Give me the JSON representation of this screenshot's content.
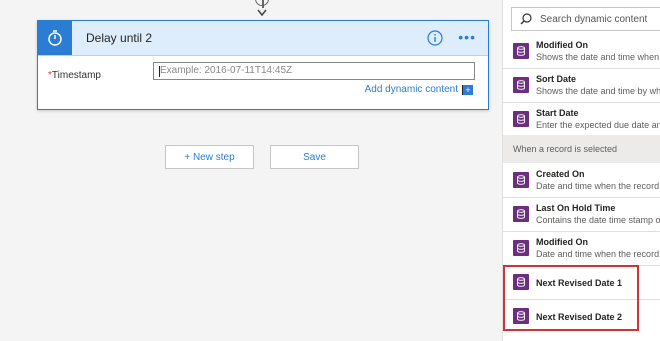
{
  "card": {
    "title": "Delay until 2",
    "field_label": "Timestamp",
    "required_mark": "*",
    "input_placeholder": "Example: 2016-07-11T14:45Z",
    "add_dynamic_label": "Add dynamic content"
  },
  "buttons": {
    "new_step": "+ New step",
    "save": "Save"
  },
  "panel": {
    "search_placeholder": "Search dynamic content",
    "items_top": [
      {
        "title": "Modified On",
        "desc": "Shows the date and time when"
      },
      {
        "title": "Sort Date",
        "desc": "Shows the date and time by wh"
      },
      {
        "title": "Start Date",
        "desc": "Enter the expected due date an"
      }
    ],
    "section_title": "When a record is selected",
    "items_bottom": [
      {
        "title": "Created On",
        "desc": "Date and time when the record"
      },
      {
        "title": "Last On Hold Time",
        "desc": "Contains the date time stamp o"
      },
      {
        "title": "Modified On",
        "desc": "Date and time when the record"
      },
      {
        "title": "Next Revised Date 1",
        "desc": ""
      },
      {
        "title": "Next Revised Date 2",
        "desc": ""
      }
    ]
  },
  "colors": {
    "accent": "#2b7cd3",
    "item_icon": "#6b2f7e",
    "highlight": "#d13438"
  }
}
